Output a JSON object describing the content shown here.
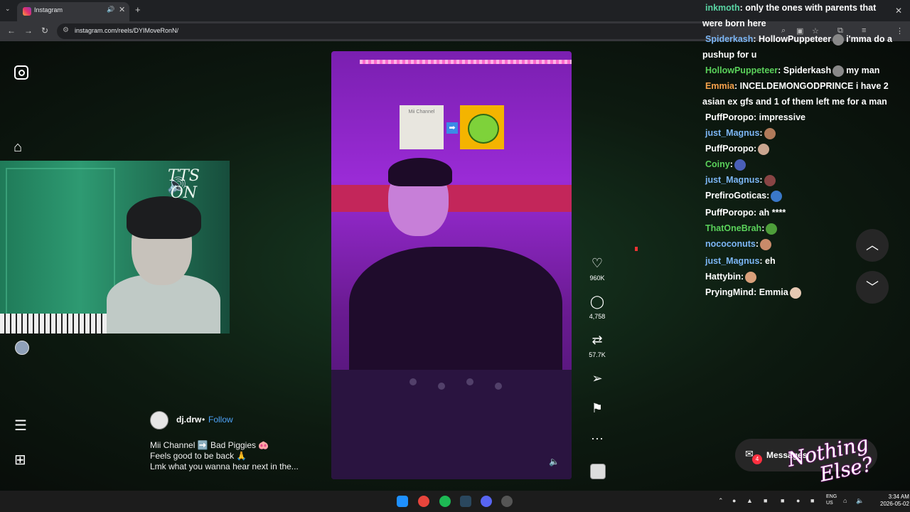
{
  "browser": {
    "tab_title": "Instagram",
    "url": "instagram.com/reels/DYIMoveRonN/"
  },
  "webcam": {
    "overlay_text_line1": "TTS",
    "overlay_text_line2": "ON"
  },
  "reel": {
    "mii_label": "Mii Channel",
    "likes": "960K",
    "comments": "4,758",
    "reposts": "57.7K"
  },
  "caption": {
    "username": "dj.drw",
    "separator": "•",
    "follow": "Follow",
    "line1": "Mii Channel ➡️ Bad Piggies 🐽",
    "line2": "Feels good to be back 🙏",
    "line3": "Lmk what you wanna hear next in the..."
  },
  "chat": [
    {
      "user": "inkmoth",
      "color": "#59d4a3",
      "text": ": only the ones with parents that",
      "cont": "were born here"
    },
    {
      "user": "Spiderkash",
      "color": "#7cb6f5",
      "text": ": HollowPuppeteer",
      "emote": "#888",
      "text2": "i'mma do a",
      "cont": "pushup for u"
    },
    {
      "user": "HollowPuppeteer",
      "color": "#5ad15a",
      "text": ": Spiderkash",
      "emote": "#888",
      "text2": "my man"
    },
    {
      "user": "Emmia",
      "color": "#f5a14b",
      "text": ": INCELDEMONGODPRINCE i have 2",
      "cont": "asian ex gfs and 1 of them left me for a man"
    },
    {
      "user": "PuffPoropo",
      "color": "#ffffff",
      "text": ": impressive"
    },
    {
      "user": "just_Magnus",
      "color": "#7cb6f5",
      "text": ":",
      "emote": "#b07a5a"
    },
    {
      "user": "PuffPoropo",
      "color": "#ffffff",
      "text": ":",
      "emote": "#c9a58f"
    },
    {
      "user": "Coiny",
      "color": "#5ad15a",
      "text": ":",
      "emote": "#4a5fb8"
    },
    {
      "user": "just_Magnus",
      "color": "#7cb6f5",
      "text": ":",
      "emote": "#884444"
    },
    {
      "user": "PrefiroGoticas",
      "color": "#ffffff",
      "text": ":",
      "emote": "#3a78c8"
    },
    {
      "user": "PuffPoropo",
      "color": "#ffffff",
      "text": ": ah ****"
    },
    {
      "user": "ThatOneBrah",
      "color": "#5ad15a",
      "text": ":",
      "emote": "#4e9e3a"
    },
    {
      "user": "nococonuts",
      "color": "#7cb6f5",
      "text": ":",
      "emote": "#c98a6a"
    },
    {
      "user": "just_Magnus",
      "color": "#7cb6f5",
      "text": ": eh"
    },
    {
      "user": "Hattybin",
      "color": "#ffffff",
      "text": ":",
      "emote": "#d9a07a"
    },
    {
      "user": "PryingMind",
      "color": "#ffffff",
      "text": ": Emmia",
      "emote": "#e6c9b3"
    }
  ],
  "messages": {
    "label": "Messages",
    "badge": "4"
  },
  "overlay": {
    "brand_line1": "Nothing",
    "brand_line2": "Else?"
  },
  "taskbar": {
    "lang_line1": "ENG",
    "lang_line2": "US",
    "time": "3:34 AM",
    "date": "2026-05-02"
  }
}
